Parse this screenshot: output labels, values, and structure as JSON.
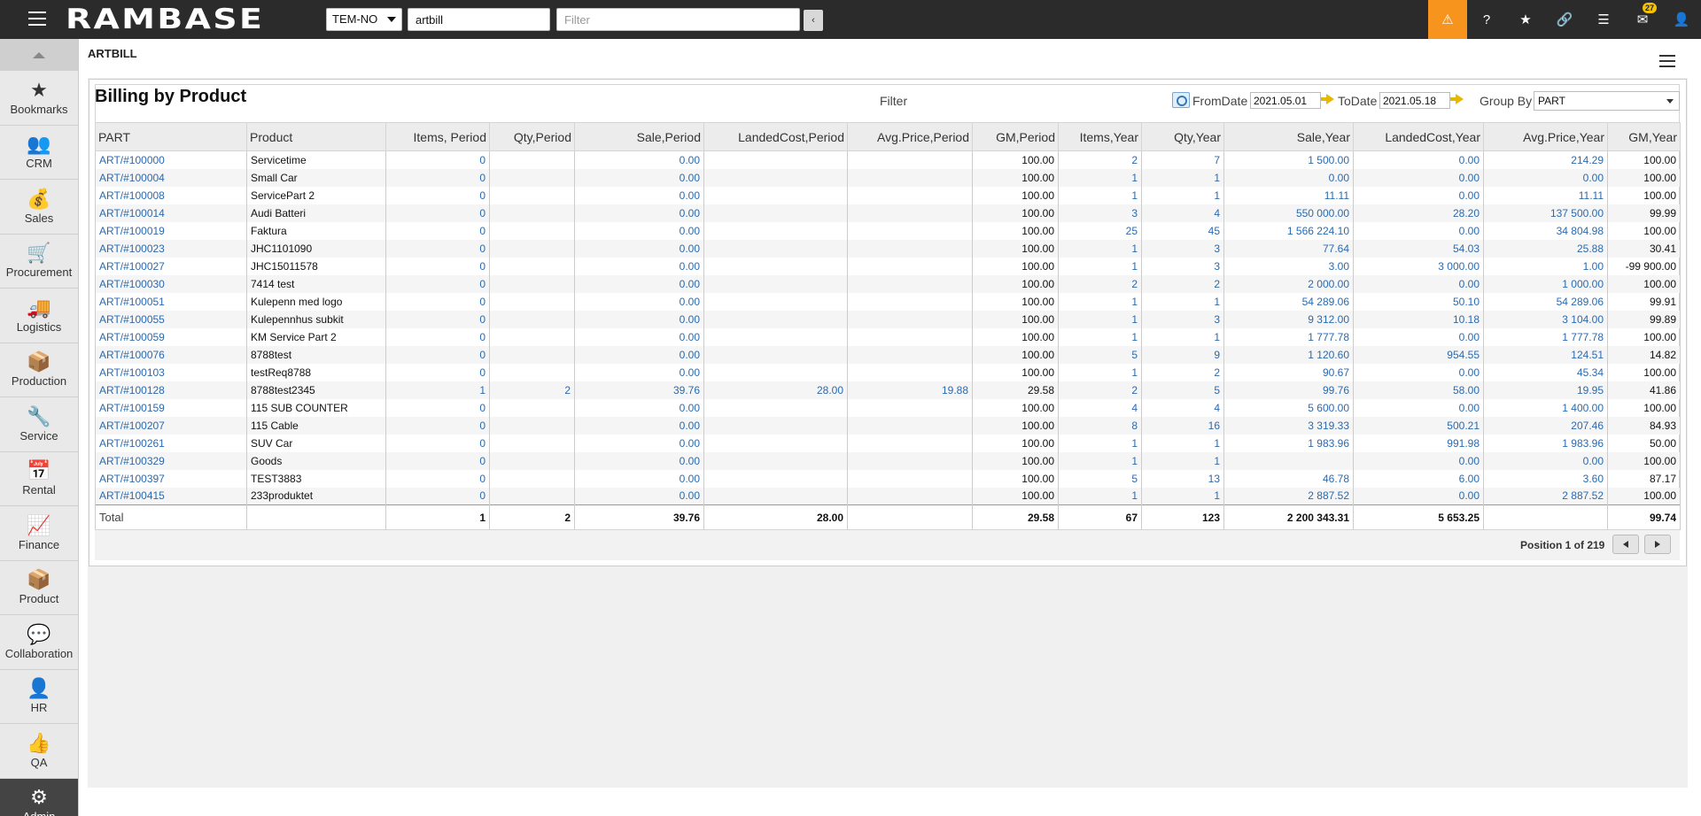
{
  "app": {
    "logo": "RAMBASE",
    "company": "TEM-NO",
    "program_search": "artbill",
    "filter_placeholder": "Filter",
    "collapse_label": "‹",
    "notification_count": "27"
  },
  "top_icons": [
    {
      "name": "warning-icon",
      "glyph": "⚠"
    },
    {
      "name": "help-icon",
      "glyph": "?"
    },
    {
      "name": "star-icon",
      "glyph": "★"
    },
    {
      "name": "paperclip-icon",
      "glyph": "🔗"
    },
    {
      "name": "list-icon",
      "glyph": "☰"
    },
    {
      "name": "mail-icon",
      "glyph": "✉"
    },
    {
      "name": "user-icon",
      "glyph": "👤"
    }
  ],
  "sidebar": {
    "items": [
      {
        "label": "Bookmarks",
        "icon": "★",
        "icon_name": "bookmark-star-icon"
      },
      {
        "label": "CRM",
        "icon": "👥",
        "icon_name": "crm-people-icon"
      },
      {
        "label": "Sales",
        "icon": "💰",
        "icon_name": "sales-money-bag-icon"
      },
      {
        "label": "Procurement",
        "icon": "🛒",
        "icon_name": "procurement-cart-icon"
      },
      {
        "label": "Logistics",
        "icon": "🚚",
        "icon_name": "logistics-truck-icon"
      },
      {
        "label": "Production",
        "icon": "📦",
        "icon_name": "production-boxes-icon"
      },
      {
        "label": "Service",
        "icon": "🔧",
        "icon_name": "service-wrench-icon"
      },
      {
        "label": "Rental",
        "icon": "📅",
        "icon_name": "rental-calendar-icon"
      },
      {
        "label": "Finance",
        "icon": "📈",
        "icon_name": "finance-chart-icon"
      },
      {
        "label": "Product",
        "icon": "📦",
        "icon_name": "product-box-icon"
      },
      {
        "label": "Collaboration",
        "icon": "💬",
        "icon_name": "collaboration-chat-icon"
      },
      {
        "label": "HR",
        "icon": "👤",
        "icon_name": "hr-person-icon"
      },
      {
        "label": "QA",
        "icon": "👍",
        "icon_name": "qa-thumbs-up-icon"
      },
      {
        "label": "Admin",
        "icon": "⚙",
        "icon_name": "admin-gear-icon"
      }
    ]
  },
  "page": {
    "program_title": "ARTBILL",
    "report_title": "Billing by Product",
    "filter_label": "Filter",
    "from_label": "FromDate",
    "from_value": "2021.05.01",
    "to_label": "ToDate",
    "to_value": "2021.05.18",
    "group_label": "Group By",
    "group_value": "PART",
    "position_text": "Position 1 of 219"
  },
  "table": {
    "headers": [
      "PART",
      "Product",
      "Items, Period",
      "Qty,Period",
      "Sale,Period",
      "LandedCost,Period",
      "Avg.Price,Period",
      "GM,Period",
      "Items,Year",
      "Qty,Year",
      "Sale,Year",
      "LandedCost,Year",
      "Avg.Price,Year",
      "GM,Year"
    ],
    "rows": [
      [
        "ART/#100000",
        "Servicetime",
        "0",
        "",
        "0.00",
        "",
        "",
        "100.00",
        "2",
        "7",
        "1 500.00",
        "0.00",
        "214.29",
        "100.00"
      ],
      [
        "ART/#100004",
        "Small Car",
        "0",
        "",
        "0.00",
        "",
        "",
        "100.00",
        "1",
        "1",
        "0.00",
        "0.00",
        "0.00",
        "100.00"
      ],
      [
        "ART/#100008",
        "ServicePart 2",
        "0",
        "",
        "0.00",
        "",
        "",
        "100.00",
        "1",
        "1",
        "11.11",
        "0.00",
        "11.11",
        "100.00"
      ],
      [
        "ART/#100014",
        "Audi Batteri",
        "0",
        "",
        "0.00",
        "",
        "",
        "100.00",
        "3",
        "4",
        "550 000.00",
        "28.20",
        "137 500.00",
        "99.99"
      ],
      [
        "ART/#100019",
        "Faktura",
        "0",
        "",
        "0.00",
        "",
        "",
        "100.00",
        "25",
        "45",
        "1 566 224.10",
        "0.00",
        "34 804.98",
        "100.00"
      ],
      [
        "ART/#100023",
        "JHC1101090",
        "0",
        "",
        "0.00",
        "",
        "",
        "100.00",
        "1",
        "3",
        "77.64",
        "54.03",
        "25.88",
        "30.41"
      ],
      [
        "ART/#100027",
        "JHC15011578",
        "0",
        "",
        "0.00",
        "",
        "",
        "100.00",
        "1",
        "3",
        "3.00",
        "3 000.00",
        "1.00",
        "-99 900.00"
      ],
      [
        "ART/#100030",
        "7414 test",
        "0",
        "",
        "0.00",
        "",
        "",
        "100.00",
        "2",
        "2",
        "2 000.00",
        "0.00",
        "1 000.00",
        "100.00"
      ],
      [
        "ART/#100051",
        "Kulepenn med logo",
        "0",
        "",
        "0.00",
        "",
        "",
        "100.00",
        "1",
        "1",
        "54 289.06",
        "50.10",
        "54 289.06",
        "99.91"
      ],
      [
        "ART/#100055",
        "Kulepennhus subkit",
        "0",
        "",
        "0.00",
        "",
        "",
        "100.00",
        "1",
        "3",
        "9 312.00",
        "10.18",
        "3 104.00",
        "99.89"
      ],
      [
        "ART/#100059",
        "KM Service Part 2",
        "0",
        "",
        "0.00",
        "",
        "",
        "100.00",
        "1",
        "1",
        "1 777.78",
        "0.00",
        "1 777.78",
        "100.00"
      ],
      [
        "ART/#100076",
        "8788test",
        "0",
        "",
        "0.00",
        "",
        "",
        "100.00",
        "5",
        "9",
        "1 120.60",
        "954.55",
        "124.51",
        "14.82"
      ],
      [
        "ART/#100103",
        "testReq8788",
        "0",
        "",
        "0.00",
        "",
        "",
        "100.00",
        "1",
        "2",
        "90.67",
        "0.00",
        "45.34",
        "100.00"
      ],
      [
        "ART/#100128",
        "8788test2345",
        "1",
        "2",
        "39.76",
        "28.00",
        "19.88",
        "29.58",
        "2",
        "5",
        "99.76",
        "58.00",
        "19.95",
        "41.86"
      ],
      [
        "ART/#100159",
        "115 SUB COUNTER",
        "0",
        "",
        "0.00",
        "",
        "",
        "100.00",
        "4",
        "4",
        "5 600.00",
        "0.00",
        "1 400.00",
        "100.00"
      ],
      [
        "ART/#100207",
        "115 Cable",
        "0",
        "",
        "0.00",
        "",
        "",
        "100.00",
        "8",
        "16",
        "3 319.33",
        "500.21",
        "207.46",
        "84.93"
      ],
      [
        "ART/#100261",
        "SUV Car",
        "0",
        "",
        "0.00",
        "",
        "",
        "100.00",
        "1",
        "1",
        "1 983.96",
        "991.98",
        "1 983.96",
        "50.00"
      ],
      [
        "ART/#100329",
        "Goods",
        "0",
        "",
        "0.00",
        "",
        "",
        "100.00",
        "1",
        "1",
        "",
        "0.00",
        "0.00",
        "100.00"
      ],
      [
        "ART/#100397",
        "TEST3883",
        "0",
        "",
        "0.00",
        "",
        "",
        "100.00",
        "5",
        "13",
        "46.78",
        "6.00",
        "3.60",
        "87.17"
      ],
      [
        "ART/#100415",
        "233produktet",
        "0",
        "",
        "0.00",
        "",
        "",
        "100.00",
        "1",
        "1",
        "2 887.52",
        "0.00",
        "2 887.52",
        "100.00"
      ]
    ],
    "total": [
      "Total",
      "",
      "1",
      "2",
      "39.76",
      "28.00",
      "",
      "29.58",
      "67",
      "123",
      "2 200 343.31",
      "5 653.25",
      "",
      "99.74"
    ]
  }
}
